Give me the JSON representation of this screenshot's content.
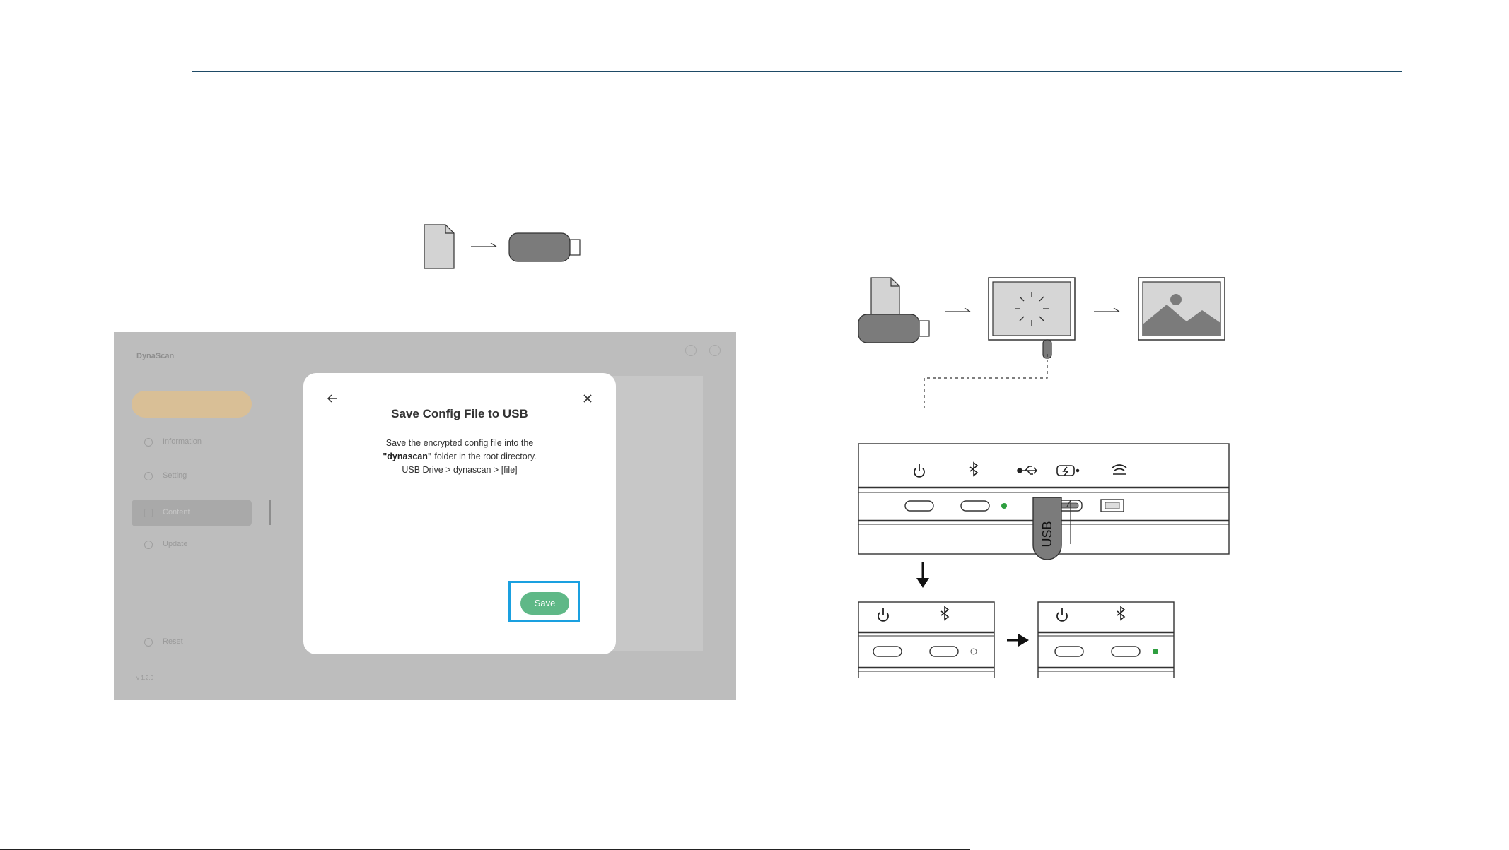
{
  "app": {
    "brand": "DynaScan",
    "top_right_text": "",
    "nav": {
      "primary_label": "",
      "items": [
        {
          "label": "Information"
        },
        {
          "label": "Setting"
        },
        {
          "label": "Content"
        },
        {
          "label": "Update"
        }
      ],
      "reset_label": "Reset",
      "version": "v 1.2.0"
    },
    "footer_links": []
  },
  "modal": {
    "title": "Save Config File to USB",
    "desc_line1": "Save the encrypted config file into the",
    "desc_bold": "\"dynascan\"",
    "desc_line2_rest": " folder in the root directory.",
    "desc_line3": "USB Drive > dynascan > [file]",
    "save_label": "Save"
  },
  "diagram": {
    "usb_label": "USB"
  },
  "colors": {
    "accent_rule": "#1e4a66",
    "save_green": "#5fb887",
    "highlight_blue": "#1aa0e0",
    "led_green": "#2e9e3f"
  }
}
